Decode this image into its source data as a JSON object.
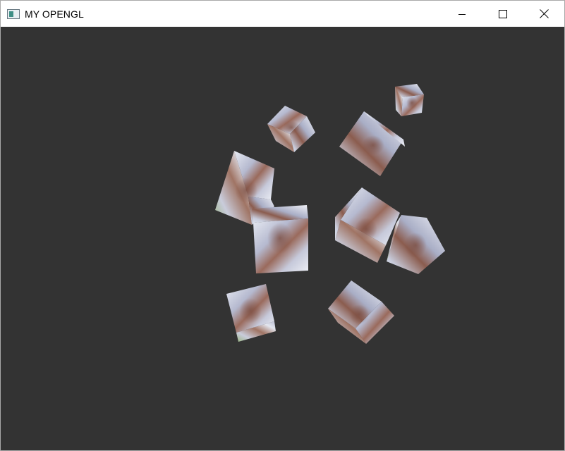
{
  "window": {
    "title": "MY OPENGL",
    "app_icon": "window-app-icon",
    "controls": [
      {
        "name": "minimize-button",
        "icon": "minimize-icon"
      },
      {
        "name": "maximize-button",
        "icon": "maximize-icon"
      },
      {
        "name": "close-button",
        "icon": "close-icon"
      }
    ]
  },
  "viewport": {
    "background": "#333333",
    "scene": "textured-rotating-cubes"
  },
  "colors": {
    "titlebar_bg": "#ffffff",
    "viewport_bg": "#333333",
    "cube_light": "#d9dde8",
    "cube_mid": "#a8adc4",
    "cube_brown": "#8a5a4c",
    "cube_green": "#8fb07a"
  }
}
